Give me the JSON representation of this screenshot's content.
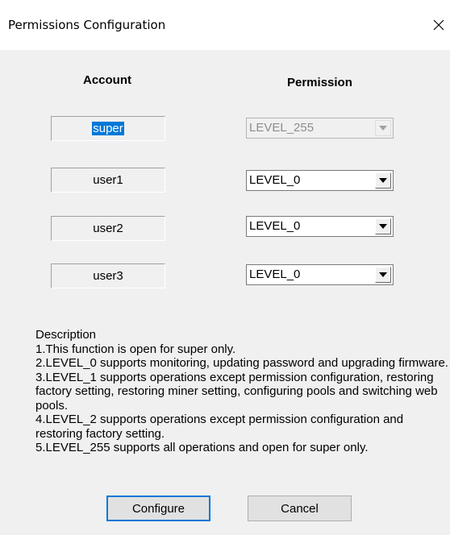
{
  "window": {
    "title": "Permissions Configuration"
  },
  "headers": {
    "account": "Account",
    "permission": "Permission"
  },
  "rows": [
    {
      "account": "super",
      "level": "LEVEL_255"
    },
    {
      "account": "user1",
      "level": "LEVEL_0"
    },
    {
      "account": "user2",
      "level": "LEVEL_0"
    },
    {
      "account": "user3",
      "level": "LEVEL_0"
    }
  ],
  "description": {
    "heading": "Description",
    "lines": [
      "1.This function is open for super only.",
      "2.LEVEL_0 supports monitoring, updating password and upgrading firmware.",
      "3.LEVEL_1 supports operations except permission configuration, restoring factory setting, restoring miner setting, configuring pools and switching web pools.",
      "4.LEVEL_2 supports operations except permission configuration and restoring factory setting.",
      "5.LEVEL_255 supports all operations and open for super only."
    ]
  },
  "buttons": {
    "configure": "Configure",
    "cancel": "Cancel"
  },
  "icons": {
    "close": "close-icon",
    "dropdown": "chevron-down-icon"
  },
  "colors": {
    "selection": "#0078d7",
    "focus_border": "#0078d7",
    "dialog_bg": "#f0f0f0"
  }
}
